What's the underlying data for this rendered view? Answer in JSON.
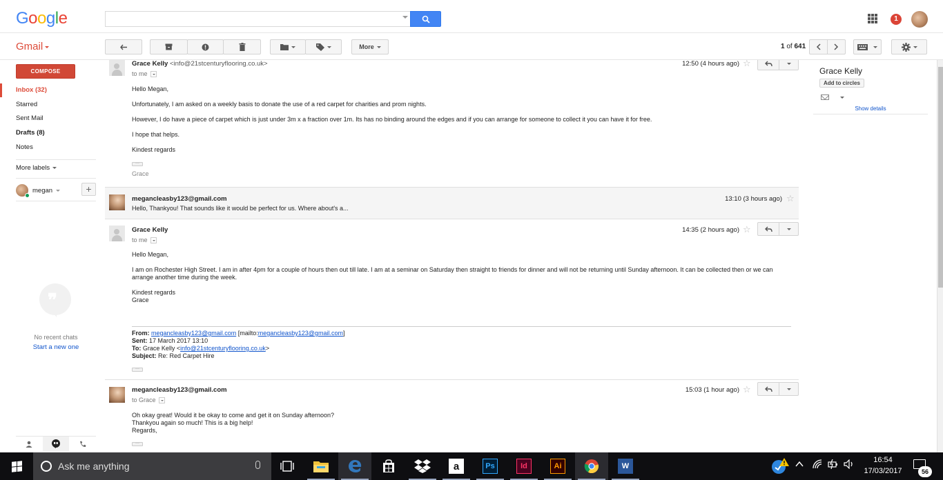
{
  "header": {
    "logo_letters": [
      "G",
      "o",
      "o",
      "g",
      "l",
      "e"
    ],
    "logo_colors": [
      "#4285f4",
      "#ea4335",
      "#fbbc05",
      "#4285f4",
      "#34a853",
      "#ea4335"
    ],
    "search": {
      "value": "",
      "placeholder": ""
    },
    "notification_count": "1"
  },
  "toolbar": {
    "app_label": "Gmail",
    "more_label": "More",
    "page_count_current": "1",
    "page_count_sep": " of ",
    "page_count_total": "641"
  },
  "sidebar": {
    "compose_label": "COMPOSE",
    "items": [
      {
        "label": "Inbox (32)"
      },
      {
        "label": "Starred"
      },
      {
        "label": "Sent Mail"
      },
      {
        "label": "Drafts (8)"
      },
      {
        "label": "Notes"
      }
    ],
    "more_labels": "More labels",
    "hangouts_user": "megan",
    "no_chats": "No recent chats",
    "start_chat": "Start a new one"
  },
  "thread": {
    "messages": [
      {
        "sender": "Grace Kelly",
        "sender_addr": "<info@21stcenturyflooring.co.uk>",
        "to_line": "to me",
        "time": "12:50 (4 hours ago)",
        "lines": [
          "Hello Megan,",
          "Unfortunately, I am asked on a weekly basis to donate the use of a red carpet for charities and prom nights.",
          "However,  I do have a piece of carpet which is just under 3m x a fraction over 1m.  Its has no binding around the edges and if you can arrange for someone to collect it you can have it for free.",
          "I hope that helps.",
          "Kindest regards"
        ],
        "signature": "Grace"
      },
      {
        "sender": "megancleasby123@gmail.com",
        "time": "13:10 (3 hours ago)",
        "snippet": "Hello, Thankyou! That sounds like it would be perfect for us. Where about's a..."
      },
      {
        "sender": "Grace Kelly",
        "to_line": "to me",
        "time": "14:35 (2 hours ago)",
        "greeting": "Hello Megan,",
        "para": "I am on Rochester High Street. I am in after 4pm for a couple of hours then out till late.  I am at a seminar on Saturday then straight to friends for dinner and will not be returning until Sunday afternoon.  It can be collected then or we can arrange another time during the week.",
        "closing_1": "Kindest regards",
        "closing_2": "Grace",
        "quote": {
          "from_label": "From:",
          "from_email": "megancleasby123@gmail.com",
          "mailto_pre": "[mailto:",
          "mailto_email": "megancleasby123@gmail.com",
          "mailto_post": "]",
          "sent_label": "Sent:",
          "sent_value": "17 March 2017 13:10",
          "to_label": "To:",
          "to_name": "Grace Kelly <",
          "to_email": "info@21stcenturyflooring.co.uk",
          "to_post": ">",
          "subject_label": "Subject:",
          "subject_value": "Re: Red Carpet Hire"
        }
      },
      {
        "sender": "megancleasby123@gmail.com",
        "to_line": "to Grace",
        "time": "15:03 (1 hour ago)",
        "line_1": "Oh okay great! Would it be okay to come and get it on Sunday afternoon?",
        "line_2": "Thankyou again so much! This is a big help!",
        "line_3": "Regards,"
      }
    ]
  },
  "contact": {
    "name": "Grace Kelly",
    "add_circles": "Add to circles",
    "show_details": "Show details"
  },
  "taskbar": {
    "search_text": "Ask me anything",
    "time": "16:54",
    "date": "17/03/2017",
    "notification_count": "56",
    "app_tiles": [
      {
        "label": "a",
        "color": "#fff",
        "bg": "#fff"
      },
      {
        "label": "Ps",
        "color": "#31a8ff",
        "bg": "#001e36"
      },
      {
        "label": "Id",
        "color": "#ff3366",
        "bg": "#49021f"
      },
      {
        "label": "Ai",
        "color": "#ff9a00",
        "bg": "#330000"
      },
      {
        "label": "W",
        "color": "#fff",
        "bg": "#2b579a"
      }
    ]
  }
}
